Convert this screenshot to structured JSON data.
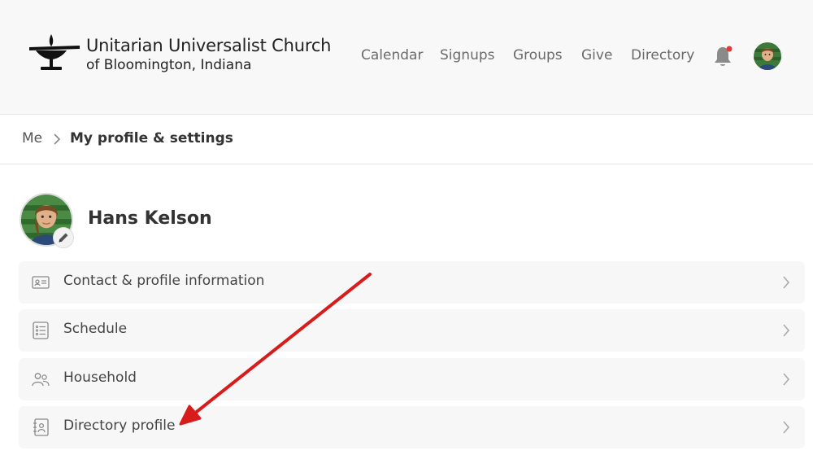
{
  "header": {
    "church_name_line1": "Unitarian Universalist Church",
    "church_name_line2": "of Bloomington, Indiana",
    "nav": [
      "Calendar",
      "Signups",
      "Groups",
      "Give",
      "Directory"
    ],
    "notification_dot_color": "#e53935"
  },
  "breadcrumb": {
    "root": "Me",
    "current": "My profile & settings"
  },
  "profile": {
    "name": "Hans Kelson"
  },
  "menu": [
    {
      "label": "Contact & profile information",
      "icon": "contact-card-icon"
    },
    {
      "label": "Schedule",
      "icon": "schedule-list-icon"
    },
    {
      "label": "Household",
      "icon": "household-people-icon"
    },
    {
      "label": "Directory profile",
      "icon": "directory-book-icon"
    }
  ],
  "annotation": {
    "arrow_color": "#d81b1b",
    "points_to": "Directory profile"
  }
}
